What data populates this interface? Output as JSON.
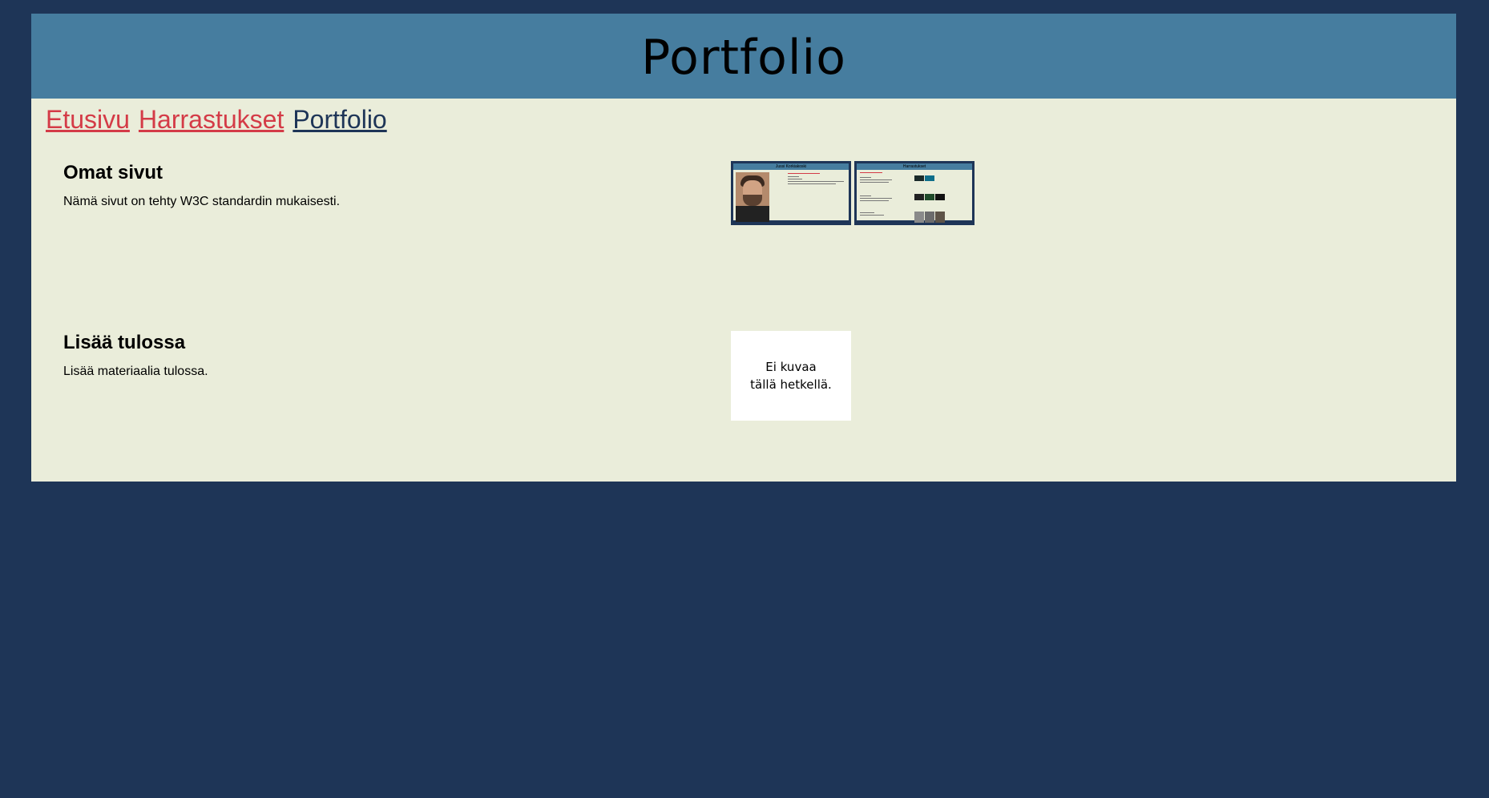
{
  "header": {
    "title": "Portfolio"
  },
  "nav": {
    "items": [
      {
        "label": "Etusivu",
        "current": false
      },
      {
        "label": "Harrastukset",
        "current": false
      },
      {
        "label": "Portfolio",
        "current": true
      }
    ]
  },
  "sections": [
    {
      "heading": "Omat sivut",
      "text": "Nämä sivut on tehty W3C standardin mukaisesti.",
      "thumbnails": [
        {
          "title": "Jussi Korkiakoski"
        },
        {
          "title": "Harrastukset"
        }
      ]
    },
    {
      "heading": "Lisää tulossa",
      "text": "Lisää materiaalia tulossa.",
      "placeholder": {
        "line1": "Ei kuvaa",
        "line2": "tällä hetkellä."
      }
    }
  ],
  "colors": {
    "background": "#1e3557",
    "content": "#eaedda",
    "header": "#467d9f",
    "link": "#d43b47",
    "link_current": "#1e3557"
  }
}
